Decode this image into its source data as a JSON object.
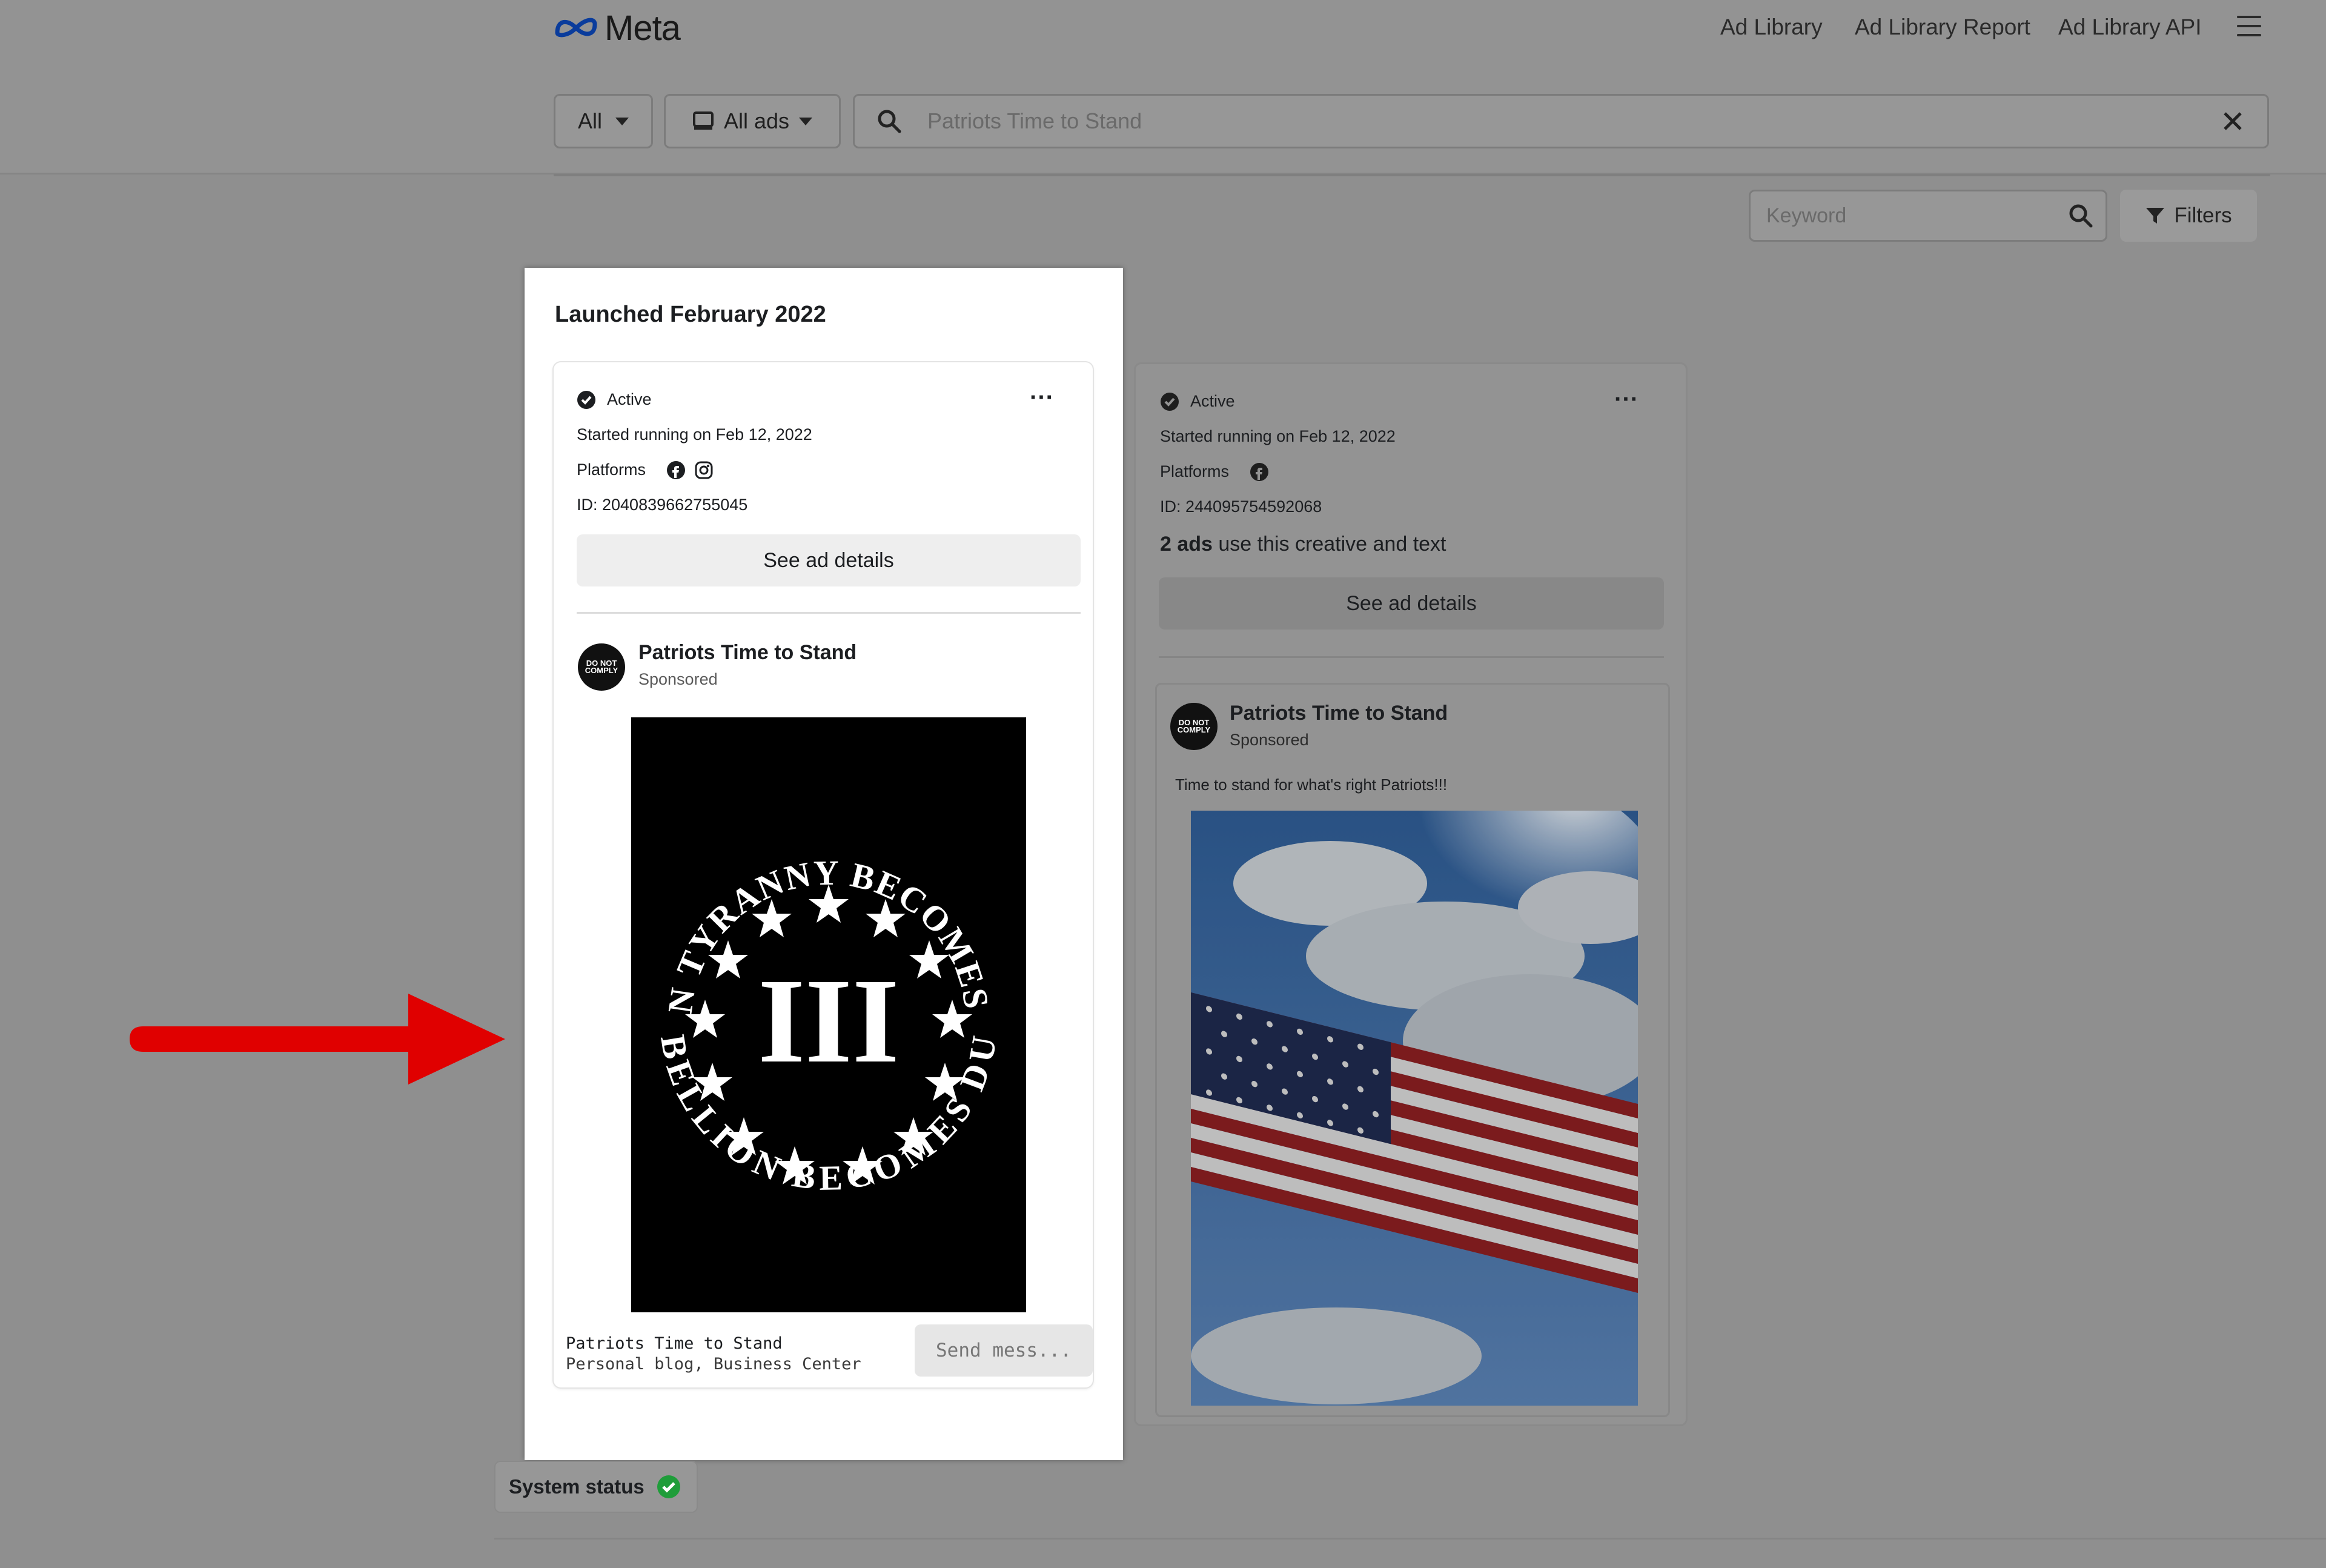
{
  "header": {
    "logo_text": "Meta",
    "nav": [
      "Ad Library",
      "Ad Library Report",
      "Ad Library API"
    ]
  },
  "search": {
    "country_label": "All",
    "type_label": "All ads",
    "query_value": "Patriots Time to Stand",
    "keyword_placeholder": "Keyword",
    "filters_label": "Filters"
  },
  "panel": {
    "title": "Launched February 2022"
  },
  "ad1": {
    "status": "Active",
    "started": "Started running on Feb 12, 2022",
    "platforms_label": "Platforms",
    "id_text": "ID: 2040839662755045",
    "details_button": "See ad details",
    "page_name": "Patriots Time to Stand",
    "sponsored": "Sponsored",
    "avatar_text": "DO NOT COMPLY",
    "creative": {
      "top_arc": "WHEN TYRANNY BECOMES LAW",
      "bottom_arc": "REBELLION BECOMES DUTY",
      "center": "III"
    },
    "footer_name": "Patriots Time to Stand",
    "footer_sub": "Personal blog, Business Center",
    "cta": "Send mess..."
  },
  "ad2": {
    "status": "Active",
    "started": "Started running on Feb 12, 2022",
    "platforms_label": "Platforms",
    "id_text": "ID: 244095754592068",
    "ads_count": "2 ads",
    "ads_count_rest": " use this creative and text",
    "details_button": "See ad details",
    "page_name": "Patriots Time to Stand",
    "sponsored": "Sponsored",
    "avatar_text": "DO NOT COMPLY",
    "body_text": "Time to stand for what's right Patriots!!!"
  },
  "system_status": "System status",
  "colors": {
    "overlay": "#8f8f8f",
    "arrow": "#e00000",
    "meta_blue": "#0a3c9c",
    "status_green": "#1f9d3a"
  }
}
